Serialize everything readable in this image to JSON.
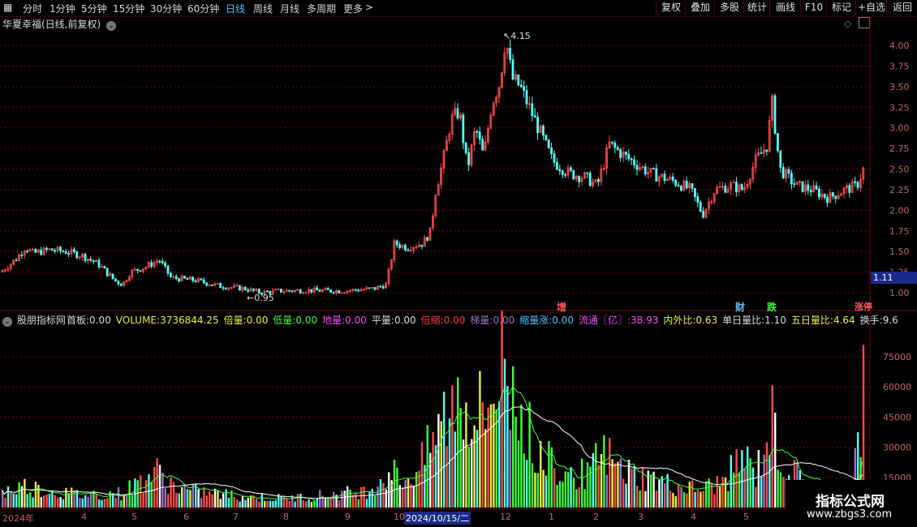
{
  "toolbar": {
    "periods": [
      "分时",
      "1分钟",
      "5分钟",
      "15分钟",
      "30分钟",
      "60分钟",
      "日线",
      "周线",
      "月线",
      "多周期",
      "更多"
    ],
    "active_period": "日线",
    "right_buttons": [
      "复权",
      "叠加",
      "多股",
      "统计",
      "画线",
      "F10",
      "标记",
      "+自选",
      "返回"
    ]
  },
  "main_chart": {
    "title": "华夏幸福(日线,前复权)",
    "high_label": "4.15",
    "low_label": "0.95",
    "current_price": "1.11",
    "price_ticks": [
      "4.00",
      "3.75",
      "3.50",
      "3.25",
      "3.00",
      "2.75",
      "2.50",
      "2.25",
      "2.00",
      "1.75",
      "1.50",
      "1.25",
      "1.00"
    ],
    "markers": [
      {
        "text": "增",
        "color": "#ff5a5a"
      },
      {
        "text": "财",
        "color": "#4fc3ff"
      },
      {
        "text": "跌",
        "color": "#3cff3c"
      },
      {
        "text": "涨停",
        "color": "#ff5a5a"
      }
    ]
  },
  "indicator": {
    "name": "股朋指标网",
    "items": [
      {
        "label": "首板:",
        "value": "0.00",
        "color": "#dcdcdc"
      },
      {
        "label": "VOLUME:",
        "value": "3736844.25",
        "color": "#f0f040"
      },
      {
        "label": "倍量:",
        "value": "0.00",
        "color": "#f0f040"
      },
      {
        "label": "低量:",
        "value": "0.00",
        "color": "#3cff3c"
      },
      {
        "label": "地量:",
        "value": "0.00",
        "color": "#ff4cff"
      },
      {
        "label": "平量:",
        "value": "0.00",
        "color": "#dcdcdc"
      },
      {
        "label": "倍缩:",
        "value": "0.00",
        "color": "#ff3c3c"
      },
      {
        "label": "梯量:",
        "value": "0.00",
        "color": "#a070c8"
      },
      {
        "label": "缩量涨:",
        "value": "0.00",
        "color": "#4fc3ff"
      },
      {
        "label": "流通〖亿〗:",
        "value": "38.93",
        "color": "#ff4cff"
      },
      {
        "label": "内外比:",
        "value": "0.63",
        "color": "#f0f040"
      },
      {
        "label": "单日量比:",
        "value": "1.10",
        "color": "#dcdcdc"
      },
      {
        "label": "五日量比:",
        "value": "4.64",
        "color": "#f0f040"
      },
      {
        "label": "换手:",
        "value": "9.6",
        "color": "#dcdcdc"
      }
    ],
    "volume_ticks": [
      "75000",
      "60000",
      "45000",
      "30000",
      "15000"
    ]
  },
  "date_axis": {
    "labels": [
      "2024年",
      "4",
      "5",
      "6",
      "7",
      "8",
      "9",
      "10",
      "2024/10/15/二",
      "12",
      "1",
      "2",
      "3",
      "4",
      "5"
    ]
  },
  "watermark": {
    "line1": "指标公式网",
    "line2": "www.zbgs3.com"
  },
  "colors": {
    "up": "#ff4c4c",
    "down": "#54ffff",
    "grid": "#7a0000",
    "ma_white": "#ffffff",
    "ma_green": "#3cff3c"
  },
  "chart_data": {
    "type": "candlestick",
    "price_axis": {
      "min": 0.95,
      "max": 4.15
    },
    "price_path": [
      [
        0,
        1.25
      ],
      [
        20,
        1.42
      ],
      [
        30,
        1.55
      ],
      [
        40,
        1.48
      ],
      [
        60,
        1.52
      ],
      [
        80,
        1.5
      ],
      [
        100,
        1.45
      ],
      [
        120,
        1.35
      ],
      [
        140,
        1.15
      ],
      [
        150,
        1.1
      ],
      [
        160,
        1.25
      ],
      [
        180,
        1.32
      ],
      [
        195,
        1.4
      ],
      [
        210,
        1.18
      ],
      [
        240,
        1.15
      ],
      [
        270,
        1.08
      ],
      [
        300,
        1.05
      ],
      [
        320,
        1.0
      ],
      [
        340,
        1.02
      ],
      [
        380,
        1.03
      ],
      [
        420,
        1.02
      ],
      [
        460,
        1.05
      ],
      [
        475,
        1.1
      ],
      [
        485,
        1.6
      ],
      [
        500,
        1.55
      ],
      [
        520,
        1.6
      ],
      [
        530,
        1.75
      ],
      [
        535,
        2.2
      ],
      [
        545,
        2.6
      ],
      [
        555,
        3.1
      ],
      [
        565,
        3.2
      ],
      [
        575,
        2.5
      ],
      [
        585,
        3.0
      ],
      [
        595,
        2.65
      ],
      [
        605,
        3.3
      ],
      [
        615,
        3.55
      ],
      [
        622,
        4.1
      ],
      [
        630,
        3.6
      ],
      [
        640,
        3.5
      ],
      [
        660,
        3.05
      ],
      [
        680,
        2.6
      ],
      [
        700,
        2.45
      ],
      [
        720,
        2.4
      ],
      [
        735,
        2.3
      ],
      [
        750,
        2.8
      ],
      [
        770,
        2.65
      ],
      [
        800,
        2.45
      ],
      [
        830,
        2.35
      ],
      [
        850,
        2.25
      ],
      [
        865,
        1.95
      ],
      [
        880,
        2.25
      ],
      [
        900,
        2.3
      ],
      [
        915,
        2.25
      ],
      [
        930,
        2.6
      ],
      [
        945,
        2.8
      ],
      [
        950,
        3.35
      ],
      [
        960,
        2.5
      ],
      [
        980,
        2.3
      ],
      [
        1000,
        2.25
      ],
      [
        1020,
        2.15
      ],
      [
        1040,
        2.25
      ],
      [
        1055,
        2.3
      ],
      [
        1065,
        2.55
      ]
    ],
    "volume_path": [
      [
        0,
        8000
      ],
      [
        30,
        12000
      ],
      [
        60,
        9000
      ],
      [
        100,
        7000
      ],
      [
        150,
        8000
      ],
      [
        190,
        20000
      ],
      [
        220,
        10000
      ],
      [
        260,
        8000
      ],
      [
        300,
        6000
      ],
      [
        350,
        5000
      ],
      [
        400,
        7000
      ],
      [
        450,
        9000
      ],
      [
        480,
        20000
      ],
      [
        500,
        15000
      ],
      [
        520,
        25000
      ],
      [
        540,
        45000
      ],
      [
        555,
        55000
      ],
      [
        565,
        65000
      ],
      [
        580,
        50000
      ],
      [
        600,
        55000
      ],
      [
        610,
        70000
      ],
      [
        618,
        80000
      ],
      [
        630,
        62000
      ],
      [
        650,
        40000
      ],
      [
        680,
        25000
      ],
      [
        700,
        20000
      ],
      [
        720,
        18000
      ],
      [
        745,
        30000
      ],
      [
        760,
        22000
      ],
      [
        780,
        18000
      ],
      [
        800,
        16000
      ],
      [
        830,
        12000
      ],
      [
        860,
        10000
      ],
      [
        890,
        14000
      ],
      [
        915,
        28000
      ],
      [
        930,
        18000
      ],
      [
        950,
        48000
      ],
      [
        965,
        22000
      ],
      [
        990,
        15000
      ],
      [
        1020,
        10000
      ],
      [
        1045,
        12000
      ],
      [
        1058,
        35000
      ],
      [
        1064,
        70000
      ]
    ]
  }
}
